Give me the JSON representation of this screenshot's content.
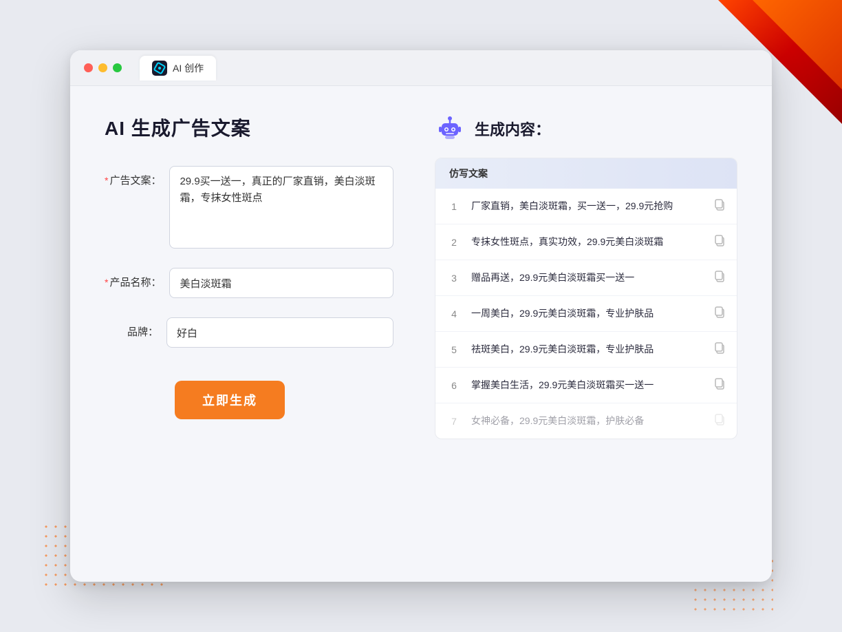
{
  "window": {
    "tab_label": "AI 创作"
  },
  "page": {
    "title": "AI 生成广告文案",
    "result_section_title": "生成内容："
  },
  "form": {
    "ad_copy_label": "广告文案：",
    "ad_copy_required": "*",
    "ad_copy_value": "29.9买一送一，真正的厂家直销，美白淡斑霜，专抹女性斑点",
    "product_name_label": "产品名称：",
    "product_name_required": "*",
    "product_name_value": "美白淡斑霜",
    "brand_label": "品牌：",
    "brand_value": "好白",
    "generate_button": "立即生成"
  },
  "result": {
    "table_header": "仿写文案",
    "items": [
      {
        "num": "1",
        "text": "厂家直销，美白淡斑霜，买一送一，29.9元抢购",
        "faded": false
      },
      {
        "num": "2",
        "text": "专抹女性斑点，真实功效，29.9元美白淡斑霜",
        "faded": false
      },
      {
        "num": "3",
        "text": "赠品再送，29.9元美白淡斑霜买一送一",
        "faded": false
      },
      {
        "num": "4",
        "text": "一周美白，29.9元美白淡斑霜，专业护肤品",
        "faded": false
      },
      {
        "num": "5",
        "text": "祛斑美白，29.9元美白淡斑霜，专业护肤品",
        "faded": false
      },
      {
        "num": "6",
        "text": "掌握美白生活，29.9元美白淡斑霜买一送一",
        "faded": false
      },
      {
        "num": "7",
        "text": "女神必备，29.9元美白淡斑霜，护肤必备",
        "faded": true
      }
    ]
  }
}
